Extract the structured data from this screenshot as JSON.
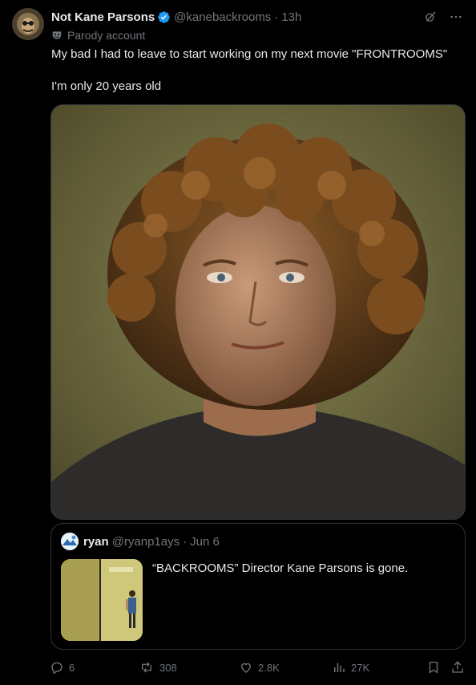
{
  "author": {
    "name": "Not Kane Parsons",
    "handle": "@kanebackrooms",
    "time": "13h",
    "label": "Parody account"
  },
  "tweet": {
    "line1": "My bad I had to leave to start working on my next movie \"FRONTROOMS\"",
    "line2": "I'm only 20 years old"
  },
  "media": {
    "icon": "photo-portrait"
  },
  "quoted": {
    "name": "ryan",
    "handle": "@ryanp1ays",
    "time": "Jun 6",
    "text": "“BACKROOMS” Director Kane Parsons is gone."
  },
  "actions": {
    "replies": "6",
    "reposts": "308",
    "likes": "2.8K",
    "views": "27K"
  },
  "colors": {
    "background": "#000000",
    "text": "#e7e9ea",
    "muted": "#71767b",
    "border": "#2f3336",
    "verified": "#1d9bf0"
  }
}
